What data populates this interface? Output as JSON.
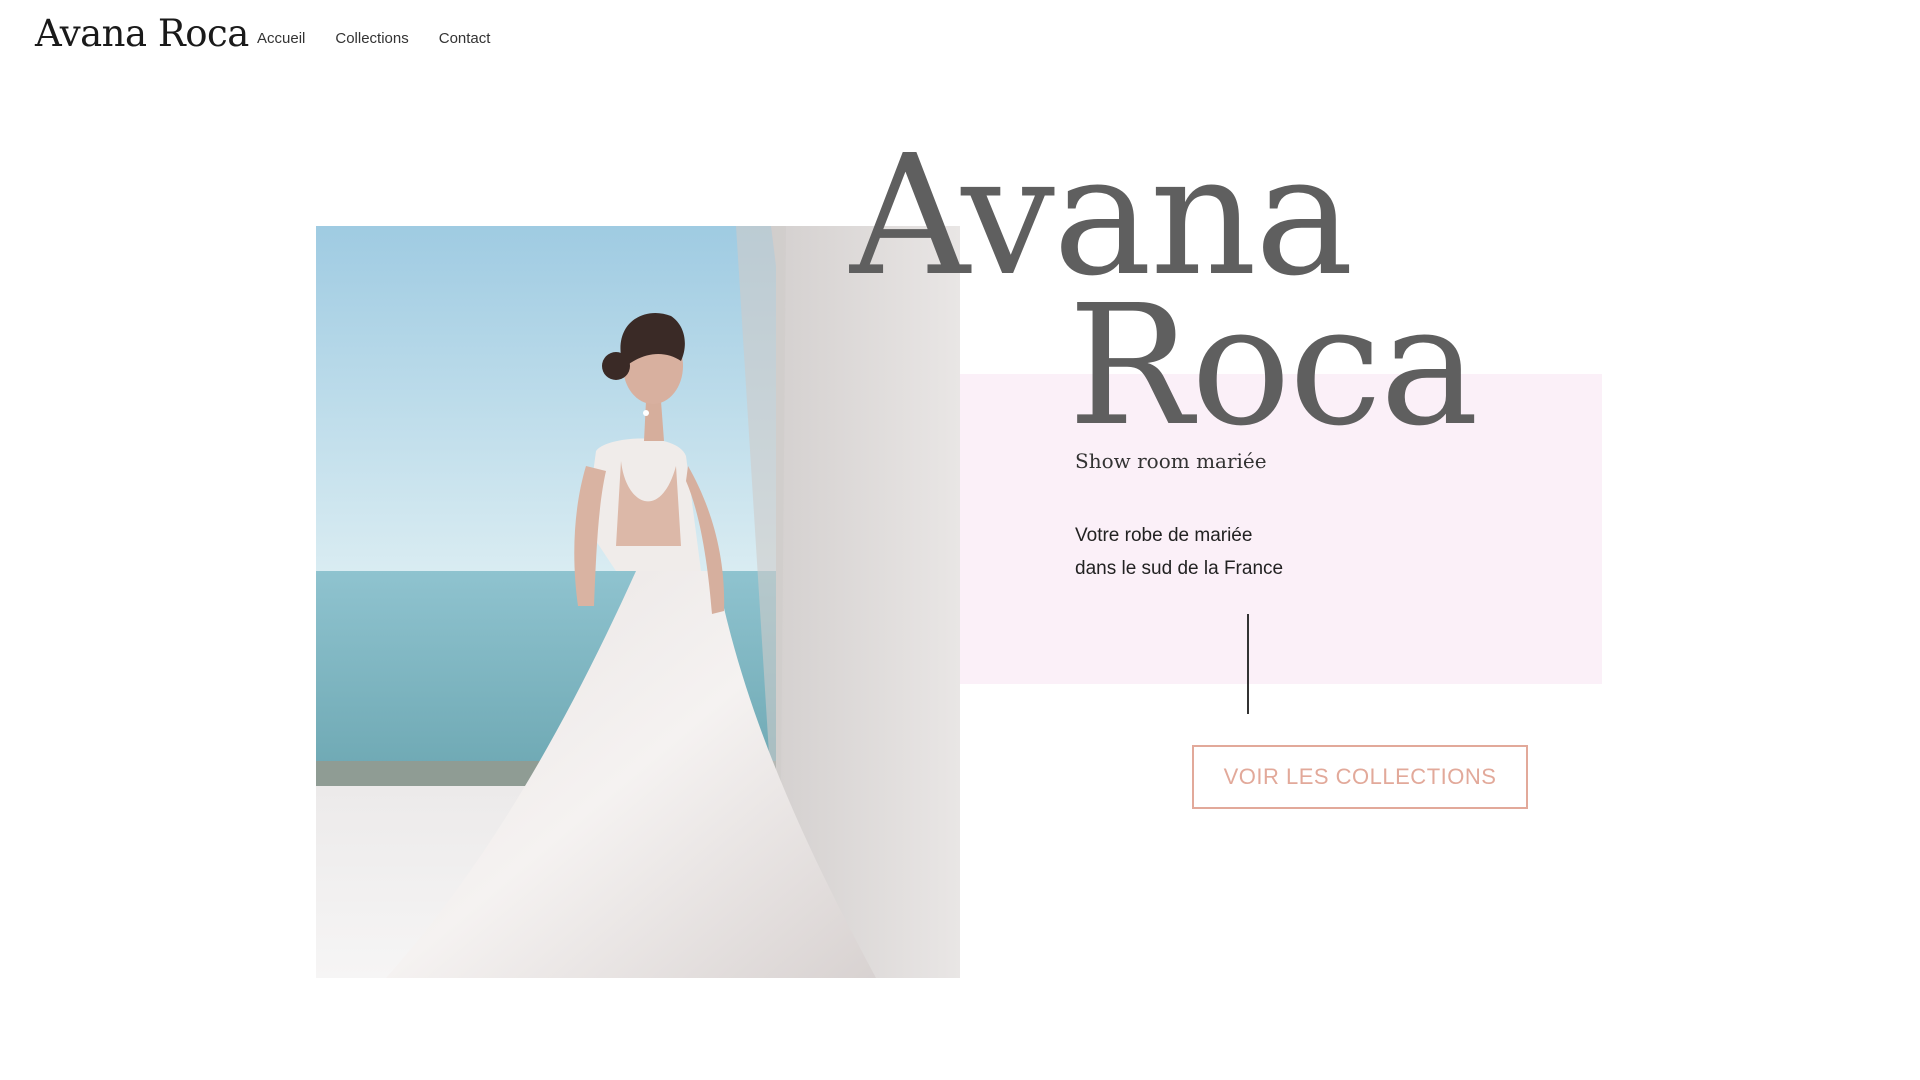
{
  "header": {
    "logo": "Avana Roca",
    "nav": [
      "Accueil",
      "Collections",
      "Contact"
    ]
  },
  "hero": {
    "title_line1": "Avana",
    "title_line2": "Roca",
    "subtitle": "Show room mariée",
    "tagline_line1": "Votre robe de mariée",
    "tagline_line2": "dans le sud de la France",
    "cta_label": "VOIR LES COLLECTIONS"
  },
  "colors": {
    "accent": "#e2a99a",
    "panel": "#fbf0f8",
    "title": "#5f5f5f"
  }
}
